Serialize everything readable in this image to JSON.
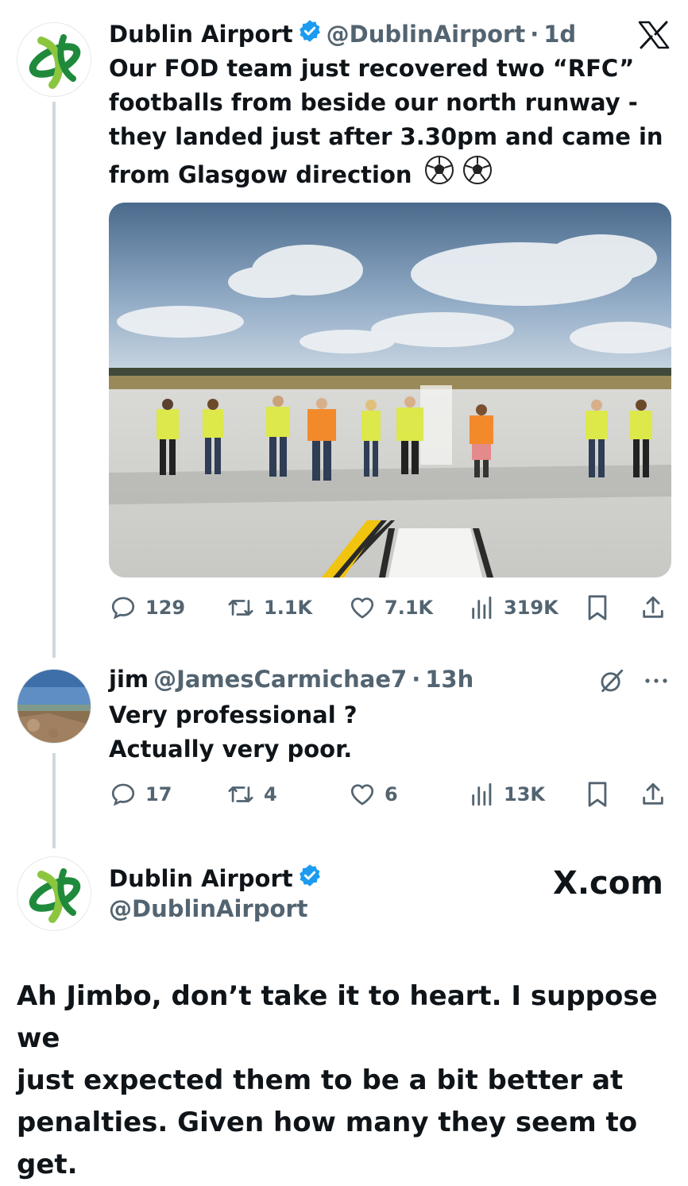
{
  "tweet": {
    "author_name": "Dublin Airport",
    "handle": "@DublinAirport",
    "separator": "·",
    "time": "1d",
    "text_lines": [
      "Our FOD team just recovered two “RFC”",
      "footballs from beside our north runway -",
      "they landed just after 3.30pm and came in",
      "from Glasgow direction"
    ],
    "emoji": "⚽ ⚽",
    "logo_icon": "x-logo-icon",
    "stats": {
      "replies": "129",
      "reposts": "1.1K",
      "likes": "7.1K",
      "views": "319K"
    }
  },
  "reply": {
    "author_name": "jim",
    "handle": "@JamesCarmichae7",
    "separator": "·",
    "time": "13h",
    "text_lines": [
      "Very professional ?",
      "Actually very poor."
    ],
    "stats": {
      "replies": "17",
      "reposts": "4",
      "likes": "6",
      "views": "13K"
    }
  },
  "response": {
    "author_name": "Dublin Airport",
    "handle": "@DublinAirport",
    "brand": "X.com",
    "text_lines": [
      "Ah Jimbo, don’t take it to heart. I suppose we",
      "just expected them to be a bit better at",
      "penalties. Given how many they seem to get."
    ]
  },
  "colors": {
    "verified": "#1d9bf0",
    "text": "#0f1419",
    "muted": "#536471",
    "thread": "#cfd9de",
    "logo_green": "#1f8a3b",
    "logo_lime": "#8cc63f"
  }
}
